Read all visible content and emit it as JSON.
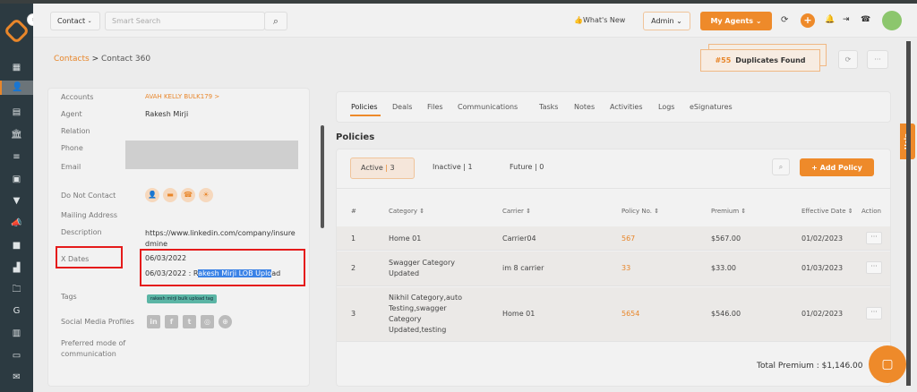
{
  "topbar": {
    "entity_select": "Contact",
    "search_placeholder": "Smart Search",
    "whats_new": "What's New",
    "admin": "Admin",
    "my_agents": "My Agents"
  },
  "breadcrumb": {
    "parent": "Contacts",
    "separator": ">",
    "current": "Contact 360"
  },
  "duplicates": {
    "count": "#55",
    "label": "Duplicates Found"
  },
  "contact": {
    "accounts_label": "Accounts",
    "accounts_value": "AVAH KELLY BULK179 >",
    "agent_label": "Agent",
    "agent_value": "Rakesh Mirji",
    "relation_label": "Relation",
    "phone_label": "Phone",
    "email_label": "Email",
    "dnc_label": "Do Not Contact",
    "mailing_label": "Mailing Address",
    "description_label": "Description",
    "description_value": "https://www.linkedin.com/company/insuredmine",
    "xdates_label": "X Dates",
    "xdate_1": "06/03/2022",
    "xdate_2_prefix": "06/03/2022 : R",
    "xdate_2_selected": "akesh Mirji LOB Uplo",
    "xdate_2_suffix": "ad",
    "tags_label": "Tags",
    "tag": "rakesh mirji bulk upload tag",
    "social_label": "Social Media Profiles",
    "preferred_label": "Preferred mode of communication"
  },
  "tabs": [
    "Policies",
    "Deals",
    "Files",
    "Communications",
    "Tasks",
    "Notes",
    "Activities",
    "Logs",
    "eSignatures"
  ],
  "policies": {
    "heading": "Policies",
    "filters": [
      {
        "label": "Active",
        "count": "3"
      },
      {
        "label": "Inactive",
        "count": "1"
      },
      {
        "label": "Future",
        "count": "0"
      }
    ],
    "add_button": "+ Add Policy",
    "columns": [
      "#",
      "Category ⇕",
      "Carrier ⇕",
      "Policy No. ⇕",
      "Premium ⇕",
      "Effective Date ⇕",
      "Action"
    ],
    "rows": [
      {
        "n": "1",
        "category": "Home 01",
        "carrier": "Carrier04",
        "policy_no": "567",
        "premium": "$567.00",
        "date": "01/02/2023"
      },
      {
        "n": "2",
        "category": "Swagger Category Updated",
        "carrier": "im 8 carrier",
        "policy_no": "33",
        "premium": "$33.00",
        "date": "01/03/2023"
      },
      {
        "n": "3",
        "category": "Nikhil Category,auto Testing,swagger Category Updated,testing",
        "carrier": "Home 01",
        "policy_no": "5654",
        "premium": "$546.00",
        "date": "01/02/2023"
      }
    ],
    "total": "Total Premium : $1,146.00"
  },
  "help": "Help",
  "colors": {
    "accent": "#ee8a2a",
    "sidebar": "#2c3a41",
    "highlight": "#e51b1b"
  }
}
